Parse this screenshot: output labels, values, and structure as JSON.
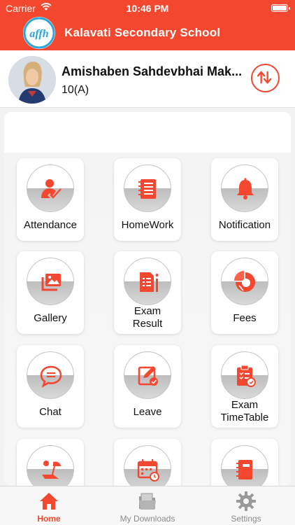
{
  "status_bar": {
    "carrier": "Carrier",
    "time": "10:46 PM"
  },
  "header": {
    "title": "Kalavati Secondary School",
    "logo_text": "affh"
  },
  "profile": {
    "name": "Amishaben Sahdevbhai Mak...",
    "class": "10(A)"
  },
  "menu": {
    "items": [
      {
        "label": "Attendance",
        "icon": "attendance-icon"
      },
      {
        "label": "HomeWork",
        "icon": "homework-icon"
      },
      {
        "label": "Notification",
        "icon": "bell-icon"
      },
      {
        "label": "Gallery",
        "icon": "gallery-icon"
      },
      {
        "label_line1": "Exam",
        "label_line2": "Result",
        "icon": "exam-result-icon"
      },
      {
        "label": "Fees",
        "icon": "fees-icon"
      },
      {
        "label": "Chat",
        "icon": "chat-icon"
      },
      {
        "label": "Leave",
        "icon": "leave-icon"
      },
      {
        "label_line1": "Exam",
        "label_line2": "TimeTable",
        "icon": "timetable-icon"
      },
      {
        "icon": "holiday-icon"
      },
      {
        "icon": "calendar-icon"
      },
      {
        "icon": "notebook-icon"
      }
    ]
  },
  "tabbar": {
    "tabs": [
      {
        "label": "Home",
        "icon": "home-icon",
        "active": true
      },
      {
        "label": "My Downloads",
        "icon": "downloads-icon",
        "active": false
      },
      {
        "label": "Settings",
        "icon": "gear-icon",
        "active": false
      }
    ]
  },
  "colors": {
    "brand": "#f4472f",
    "icon_red": "#f4472f"
  }
}
